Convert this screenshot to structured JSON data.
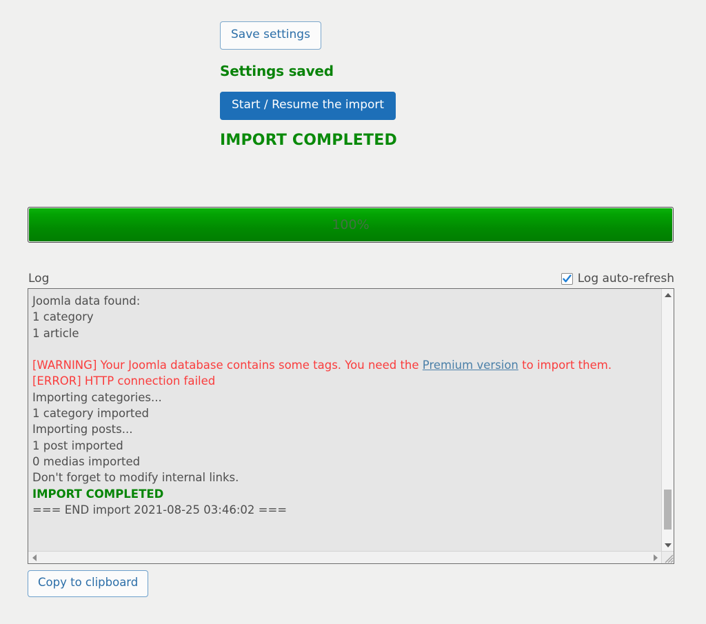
{
  "page": {
    "background_color": "#f0f0ef"
  },
  "toolbar": {
    "save_settings_label": "Save settings",
    "settings_saved_status": "Settings saved",
    "settings_saved_color": "#098309",
    "start_import_label": "Start / Resume the import",
    "start_import_color": "#1d6fb8",
    "import_completed_status": "IMPORT COMPLETED",
    "import_completed_color": "#0a8a0a"
  },
  "progress": {
    "percent_label": "100%",
    "percent_value": 100,
    "fill_color": "#019a01"
  },
  "log_header": {
    "log_label": "Log",
    "auto_refresh_label": "Log auto-refresh",
    "auto_refresh_checked": true,
    "checkbox_color": "#1f7fd4"
  },
  "log": {
    "lines": [
      {
        "text": "Joomla data found:",
        "type": "normal"
      },
      {
        "text": "1 category",
        "type": "normal"
      },
      {
        "text": "1 article",
        "type": "normal"
      },
      {
        "text": "",
        "type": "blank"
      },
      {
        "text": "[WARNING] Your Joomla database contains some tags. You need the ",
        "type": "warn",
        "link_text": "Premium version",
        "text_after": " to import them."
      },
      {
        "text": "[ERROR] HTTP connection failed",
        "type": "error"
      },
      {
        "text": "Importing categories...",
        "type": "normal"
      },
      {
        "text": "1 category imported",
        "type": "normal"
      },
      {
        "text": "Importing posts...",
        "type": "normal"
      },
      {
        "text": "1 post imported",
        "type": "normal"
      },
      {
        "text": "0 medias imported",
        "type": "normal"
      },
      {
        "text": "Don't forget to modify internal links.",
        "type": "normal"
      },
      {
        "text": "IMPORT COMPLETED",
        "type": "done"
      },
      {
        "text": "=== END import 2021-08-25 03:46:02 ===",
        "type": "normal"
      }
    ],
    "warn_color": "#fa3c3c",
    "done_color": "#068506",
    "link_color": "#4a7fa8"
  },
  "footer": {
    "copy_label": "Copy to clipboard"
  }
}
